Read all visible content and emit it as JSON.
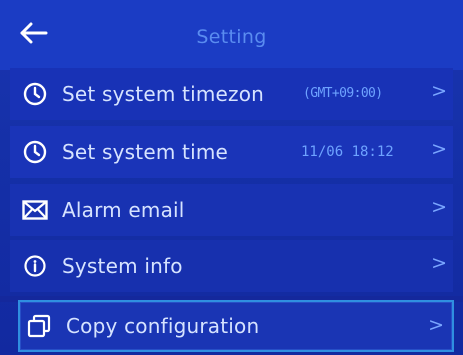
{
  "header": {
    "title": "Setting",
    "back_icon": "arrow-left-icon"
  },
  "menu": {
    "items": [
      {
        "label": "Set system timezon",
        "value": "(GMT+09:00)",
        "chevron": ">",
        "icon": "clock-icon"
      },
      {
        "label": "Set system time",
        "value": "11/06 18:12",
        "chevron": ">",
        "icon": "clock-icon"
      },
      {
        "label": "Alarm email",
        "value": "",
        "chevron": ">",
        "icon": "envelope-icon"
      },
      {
        "label": "System info",
        "value": "",
        "chevron": ">",
        "icon": "info-icon"
      },
      {
        "label": "Copy configuration",
        "value": "",
        "chevron": ">",
        "icon": "copy-icon",
        "selected": true
      }
    ]
  },
  "colors": {
    "background": "#1530a8",
    "header": "#1b3cc4",
    "title": "#5a8cf0",
    "label": "#d6e3ff",
    "value": "#6ea3ff",
    "selected_border": "#2f8fe0"
  }
}
